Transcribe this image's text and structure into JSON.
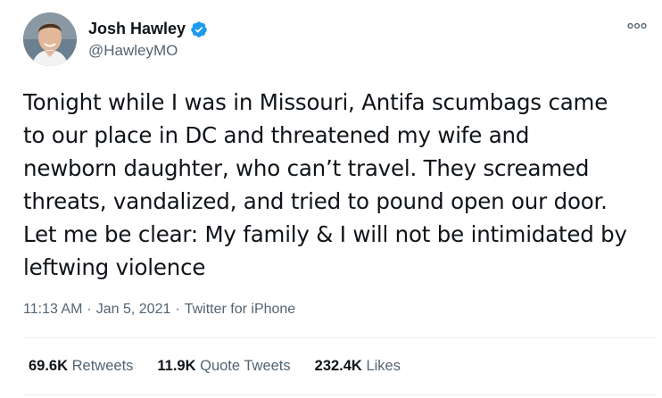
{
  "author": {
    "display_name": "Josh Hawley",
    "handle": "@HawleyMO",
    "verified": true,
    "avatar_icon": "profile-photo"
  },
  "more_icon": "ellipsis-icon",
  "tweet": {
    "text": "Tonight while I was in Missouri, Antifa scumbags came\nto our place in DC and threatened my wife and\nnewborn daughter, who can’t travel. They screamed\nthreats, vandalized, and tried to pound open our door.\nLet me be clear: My family & I will not be intimidated by\nleftwing violence"
  },
  "meta": {
    "time": "11:13 AM",
    "separator": "·",
    "date": "Jan 5, 2021",
    "source": "Twitter for iPhone"
  },
  "stats": {
    "retweets": {
      "count": "69.6K",
      "label": "Retweets"
    },
    "quote_tweets": {
      "count": "11.9K",
      "label": "Quote Tweets"
    },
    "likes": {
      "count": "232.4K",
      "label": "Likes"
    }
  },
  "colors": {
    "text_primary": "#0f1419",
    "text_secondary": "#536471",
    "verified_blue": "#1d9bf0",
    "divider": "#e6ecf0"
  }
}
